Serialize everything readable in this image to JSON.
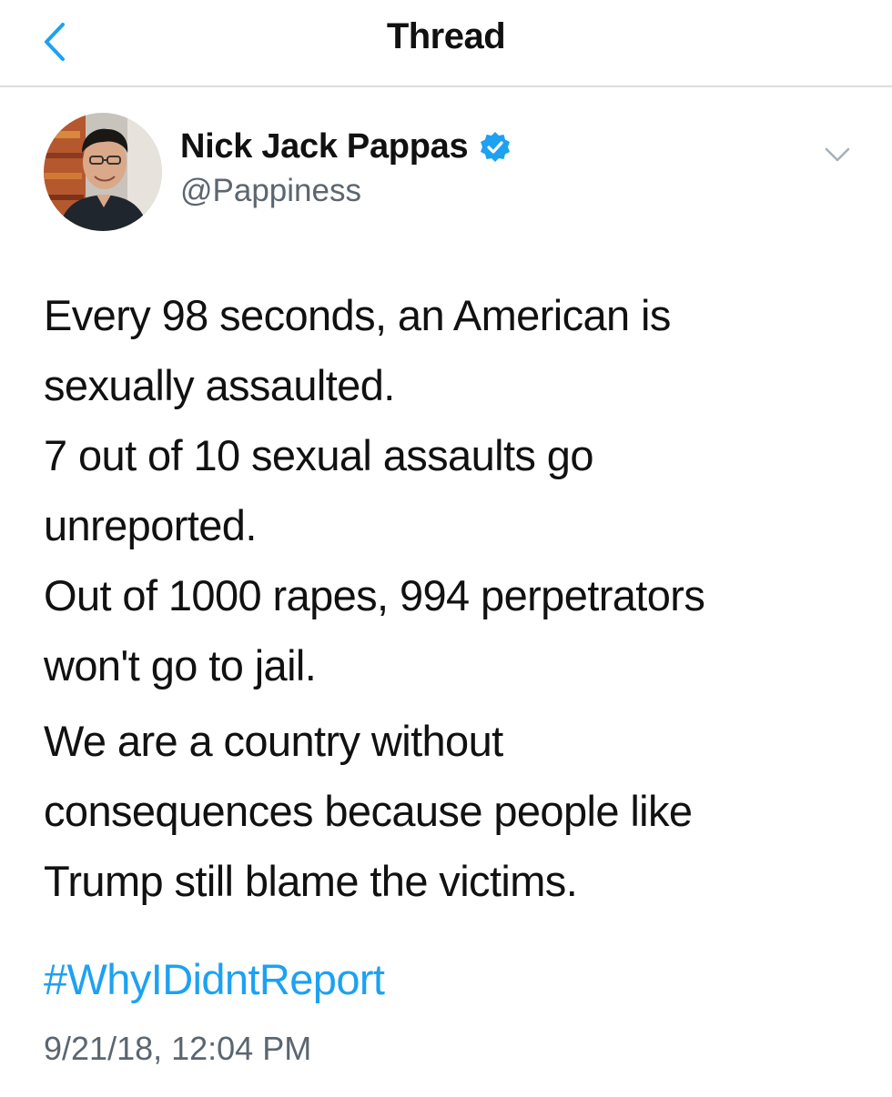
{
  "header": {
    "title": "Thread",
    "back_icon": "chevron-left-icon"
  },
  "author": {
    "name": "Nick Jack Pappas",
    "handle": "@Pappiness",
    "verified_icon": "verified-badge-icon"
  },
  "colors": {
    "accent": "#1da1f2",
    "secondary_text": "#5b6670"
  },
  "tweet": {
    "paragraphs": [
      {
        "lines": [
          "Every 98 seconds, an American is",
          "sexually assaulted.",
          "7 out of 10 sexual assaults go",
          "unreported.",
          "Out of 1000 rapes, 994 perpetrators",
          "won't go to jail."
        ]
      },
      {
        "lines": [
          "We are a country without",
          "consequences because people like",
          "Trump still blame the victims."
        ]
      }
    ],
    "hashtag": "#WhyIDidntReport",
    "timestamp": "9/21/18, 12:04 PM"
  }
}
